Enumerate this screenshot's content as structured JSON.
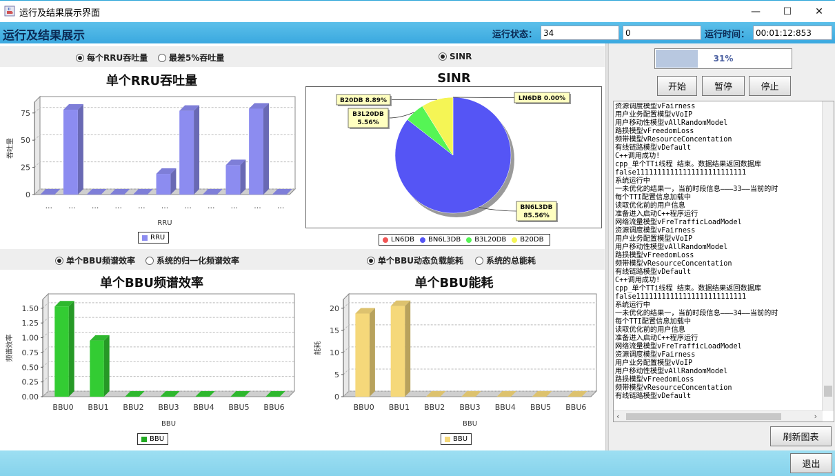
{
  "window": {
    "title": "运行及结果展示界面",
    "icon": "java-cup-icon",
    "minimize": "—",
    "maximize": "☐",
    "close": "✕"
  },
  "header": {
    "title": "运行及结果展示",
    "status_label": "运行状态：",
    "status_value_1": "34",
    "status_value_2": "0",
    "time_label": "运行时间：",
    "time_value": "00:01:12:853"
  },
  "panels": {
    "rru": {
      "radio1": "每个RRU吞吐量",
      "radio1_selected": true,
      "radio2": "最差5%吞吐量",
      "radio2_selected": false
    },
    "sinr": {
      "radio1": "SINR",
      "radio1_selected": true
    },
    "bbu_eff": {
      "radio1": "单个BBU频谱效率",
      "radio1_selected": true,
      "radio2": "系统的归一化频谱效率",
      "radio2_selected": false
    },
    "bbu_energy": {
      "radio1": "单个BBU动态负载能耗",
      "radio1_selected": true,
      "radio2": "系统的总能耗",
      "radio2_selected": false
    }
  },
  "chart_data": [
    {
      "type": "bar",
      "title": "单个RRU吞吐量",
      "xlabel": "RRU",
      "ylabel": "吞吐量",
      "categories": [
        "...",
        "...",
        "...",
        "...",
        "...",
        "...",
        "...",
        "...",
        "...",
        "...",
        "..."
      ],
      "series": [
        {
          "name": "RRU",
          "values": [
            0,
            78,
            0,
            0,
            0,
            19,
            77,
            0,
            27,
            79,
            0
          ]
        }
      ],
      "ylim": [
        0,
        85
      ],
      "yticks": [
        "0",
        "25",
        "50",
        "75"
      ],
      "color": "#8c8cf0",
      "grid": true,
      "legend": "bottom"
    },
    {
      "type": "pie",
      "title": "SINR",
      "slices": [
        {
          "name": "LN6DB",
          "value": 0.0,
          "label": "LN6DB  0.00%",
          "color": "#f25555"
        },
        {
          "name": "BN6L3DB",
          "value": 85.56,
          "label": "BN6L3DB\n85.56%",
          "color": "#5555f5"
        },
        {
          "name": "B3L20DB",
          "value": 5.56,
          "label": "B3L20DB\n5.56%",
          "color": "#55f555"
        },
        {
          "name": "B20DB",
          "value": 8.89,
          "label": "B20DB  8.89%",
          "color": "#f5f555"
        }
      ],
      "legend": "bottom"
    },
    {
      "type": "bar",
      "title": "单个BBU频谱效率",
      "xlabel": "BBU",
      "ylabel": "频谱效率",
      "categories": [
        "BBU0",
        "BBU1",
        "BBU2",
        "BBU3",
        "BBU4",
        "BBU5",
        "BBU6"
      ],
      "series": [
        {
          "name": "BBU",
          "values": [
            1.53,
            0.95,
            0,
            0,
            0,
            0,
            0
          ]
        }
      ],
      "ylim": [
        0,
        1.65
      ],
      "yticks": [
        "0.00",
        "0.25",
        "0.50",
        "0.75",
        "1.00",
        "1.25",
        "1.50"
      ],
      "color": "#33cc33",
      "grid": true,
      "legend": "bottom"
    },
    {
      "type": "bar",
      "title": "单个BBU能耗",
      "xlabel": "BBU",
      "ylabel": "能耗",
      "categories": [
        "BBU0",
        "BBU1",
        "BBU2",
        "BBU3",
        "BBU4",
        "BBU5",
        "BBU6"
      ],
      "series": [
        {
          "name": "BBU",
          "values": [
            18.8,
            20.5,
            0,
            0,
            0,
            0,
            0
          ]
        }
      ],
      "ylim": [
        0,
        22
      ],
      "yticks": [
        "0",
        "5",
        "10",
        "15",
        "20"
      ],
      "color": "#f5d87a",
      "grid": true,
      "legend": "bottom"
    }
  ],
  "control": {
    "progress_value": 0.31,
    "progress_text": "31%",
    "start": "开始",
    "pause": "暂停",
    "stop": "停止",
    "refresh": "刷新图表",
    "exit": "退出"
  },
  "log_lines": [
    "资源调度模型vFairness",
    "用户业务配置模型vVoIP",
    "用户移动性模型vAllRandomModel",
    "路损模型vFreedomLoss",
    "频带模型vResourceConcentation",
    "有线链路模型vDefault",
    "C++调用成功!",
    "cpp_单个TTi线程 结束。数据结果返回数据库",
    "false11111111111111111111111111",
    "系统运行中",
    "一未优化的结果一，当前时段信息———33——当前的时",
    "每个TTI配置信息加载中",
    "读取优化前的用户信息",
    "准备进入启动C++程序运行",
    "网络流量模型vFreTrafficLoadModel",
    "资源调度模型vFairness",
    "用户业务配置模型vVoIP",
    "用户移动性模型vAllRandomModel",
    "路损模型vFreedomLoss",
    "频带模型vResourceConcentation",
    "有线链路模型vDefault",
    "C++调用成功!",
    "cpp_单个TTi线程 结束。数据结果返回数据库",
    "false11111111111111111111111111",
    "系统运行中",
    "一未优化的结果一，当前时段信息———34——当前的时",
    "每个TTI配置信息加载中",
    "读取优化前的用户信息",
    "准备进入启动C++程序运行",
    "网络流量模型vFreTrafficLoadModel",
    "资源调度模型vFairness",
    "用户业务配置模型vVoIP",
    "用户移动性模型vAllRandomModel",
    "路损模型vFreedomLoss",
    "频带模型vResourceConcentation",
    "有线链路模型vDefault"
  ]
}
